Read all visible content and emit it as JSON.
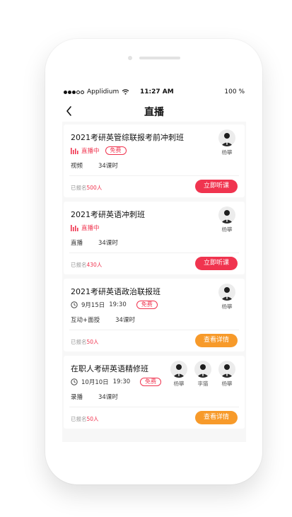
{
  "status_bar": {
    "carrier": "Applidium",
    "time": "11:27 AM",
    "battery": "100 %"
  },
  "nav": {
    "title": "直播"
  },
  "courses": [
    {
      "title": "2021考研英管综联报考前冲刺班",
      "status": "直播中",
      "free": "免费",
      "type": "视频",
      "lessons": "34课时",
      "enroll_prefix": "已报名",
      "enroll_count": "500人",
      "button": "立即听课",
      "button_color": "#f0344f",
      "teachers": [
        "杨攀"
      ]
    },
    {
      "title": "2021考研英语冲刺班",
      "status": "直播中",
      "type": "直播",
      "lessons": "34课时",
      "enroll_prefix": "已报名",
      "enroll_count": "430人",
      "button": "立即听课",
      "button_color": "#f0344f",
      "teachers": [
        "杨攀"
      ]
    },
    {
      "title": "2021考研英语政治联报班",
      "date": "9月15日",
      "time": "19:30",
      "free": "免费",
      "type": "互动+面授",
      "lessons": "34课时",
      "enroll_prefix": "已报名",
      "enroll_count": "50人",
      "button": "查看详情",
      "button_color": "#f79a2a",
      "teachers": [
        "杨攀"
      ]
    },
    {
      "title": "在职人考研英语精修班",
      "date": "10月10日",
      "time": "19:30",
      "free": "免费",
      "type": "录播",
      "lessons": "34课时",
      "enroll_prefix": "已报名",
      "enroll_count": "50人",
      "button": "查看详情",
      "button_color": "#f79a2a",
      "teachers": [
        "杨攀",
        "李猫",
        "杨攀"
      ]
    }
  ],
  "colors": {
    "accent_red": "#f0344f",
    "accent_orange": "#f79a2a",
    "background": "#f7f7f7"
  },
  "icons": {
    "back": "chevron-left-icon",
    "live": "live-bars-icon",
    "clock": "clock-icon",
    "wifi": "wifi-icon"
  }
}
